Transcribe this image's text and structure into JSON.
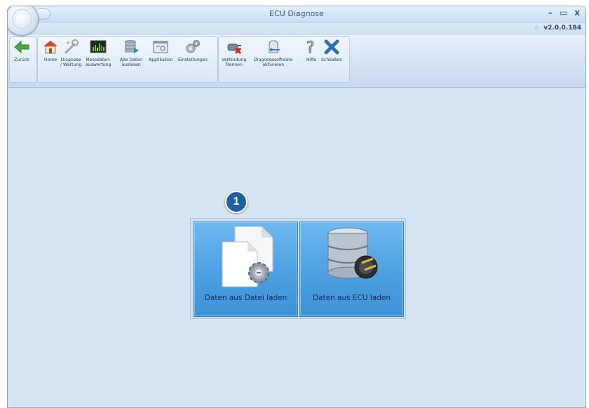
{
  "window": {
    "title": "ECU Diagnose",
    "version": "v2.0.0.184",
    "controls": {
      "minimize": "–",
      "maximize": "▭",
      "close": "x"
    }
  },
  "toolbar": {
    "back_label": "Zurück",
    "home_label": "Home",
    "diagnose_label_1": "Diagnose",
    "diagnose_label_2": "/ Wartung",
    "messdaten_label_1": "Messdaten-",
    "messdaten_label_2": "auswertung",
    "alle_daten_label_1": "Alle Daten",
    "alle_daten_label_2": "auslesen",
    "applikation_label": "Applikation",
    "einstellungen_label": "Einstellungen",
    "verbindung_label_1": "Verbindung",
    "verbindung_label_2": "Trennen",
    "diagnosesoftware_label_1": "Diagnosesoftware",
    "diagnosesoftware_label_2": "aktivieren",
    "hilfe_label": "Hilfe",
    "schliessen_label": "Schließen"
  },
  "main": {
    "tile_file_label": "Daten aus Datei laden",
    "tile_ecu_label": "Daten aus ECU laden",
    "callout_number": "1"
  }
}
